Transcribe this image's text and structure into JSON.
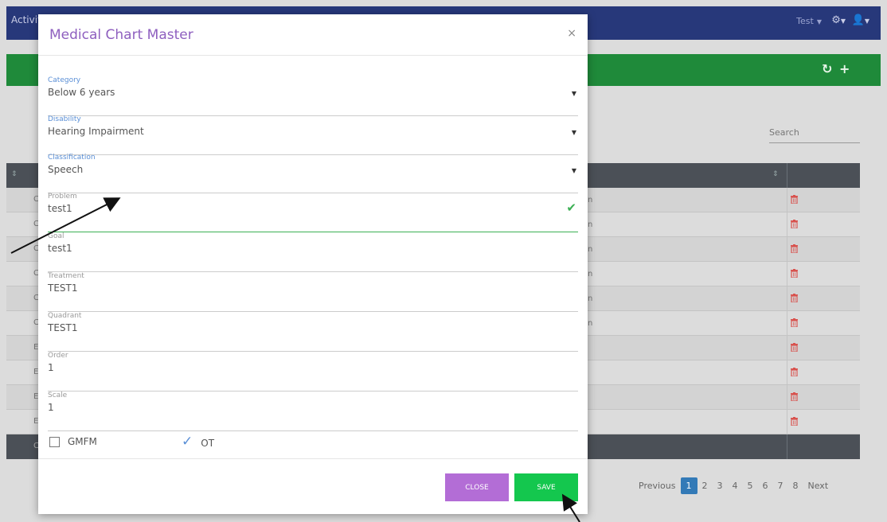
{
  "app": {
    "title_partial": "Activit",
    "user_name": "Test"
  },
  "modal": {
    "title": "Medical Chart Master",
    "close_glyph": "×",
    "fields": {
      "category": {
        "label": "Category",
        "value": "Below 6 years"
      },
      "disability": {
        "label": "Disability",
        "value": "Hearing Impairment"
      },
      "classification": {
        "label": "Classification",
        "value": "Speech"
      },
      "problem": {
        "label": "Problem",
        "value": "test1"
      },
      "goal": {
        "label": "Goal",
        "value": "test1"
      },
      "treatment": {
        "label": "Treatment",
        "value": "TEST1"
      },
      "quadrant": {
        "label": "Quadrant",
        "value": "TEST1"
      },
      "order": {
        "label": "Order",
        "value": "1"
      },
      "scale": {
        "label": "Scale",
        "value": "1"
      }
    },
    "checkboxes": {
      "gmfm": {
        "label": "GMFM",
        "checked": false
      },
      "ot": {
        "label": "OT",
        "checked": true
      }
    },
    "buttons": {
      "close": "CLOSE",
      "save": "SAVE"
    }
  },
  "background": {
    "search_label": "Search",
    "row_first_letters": [
      "C",
      "C",
      "C",
      "C",
      "C",
      "C",
      "E",
      "E",
      "E",
      "E"
    ],
    "row_fragments": [
      "n",
      "n",
      "n",
      "n",
      "n",
      "n",
      "",
      "",
      "",
      ""
    ],
    "footer_first_letter": "C",
    "pagination": {
      "previous": "Previous",
      "pages": [
        "1",
        "2",
        "3",
        "4",
        "5",
        "6",
        "7",
        "8"
      ],
      "active_page": "1",
      "next": "Next"
    }
  },
  "colors": {
    "topbar": "#27387a",
    "greenbar": "#1f8a3a",
    "modal_title": "#8e5fbf",
    "close_button": "#b36dd6",
    "save_button": "#14c74e",
    "valid_check": "#3cb054",
    "delete_icon": "#d9534f"
  },
  "icons": {
    "refresh": "refresh-icon",
    "add": "plus-icon",
    "gear": "gear-icon",
    "user": "user-icon",
    "delete": "trash-icon",
    "dropdown": "caret-down-icon",
    "valid": "check-icon"
  }
}
